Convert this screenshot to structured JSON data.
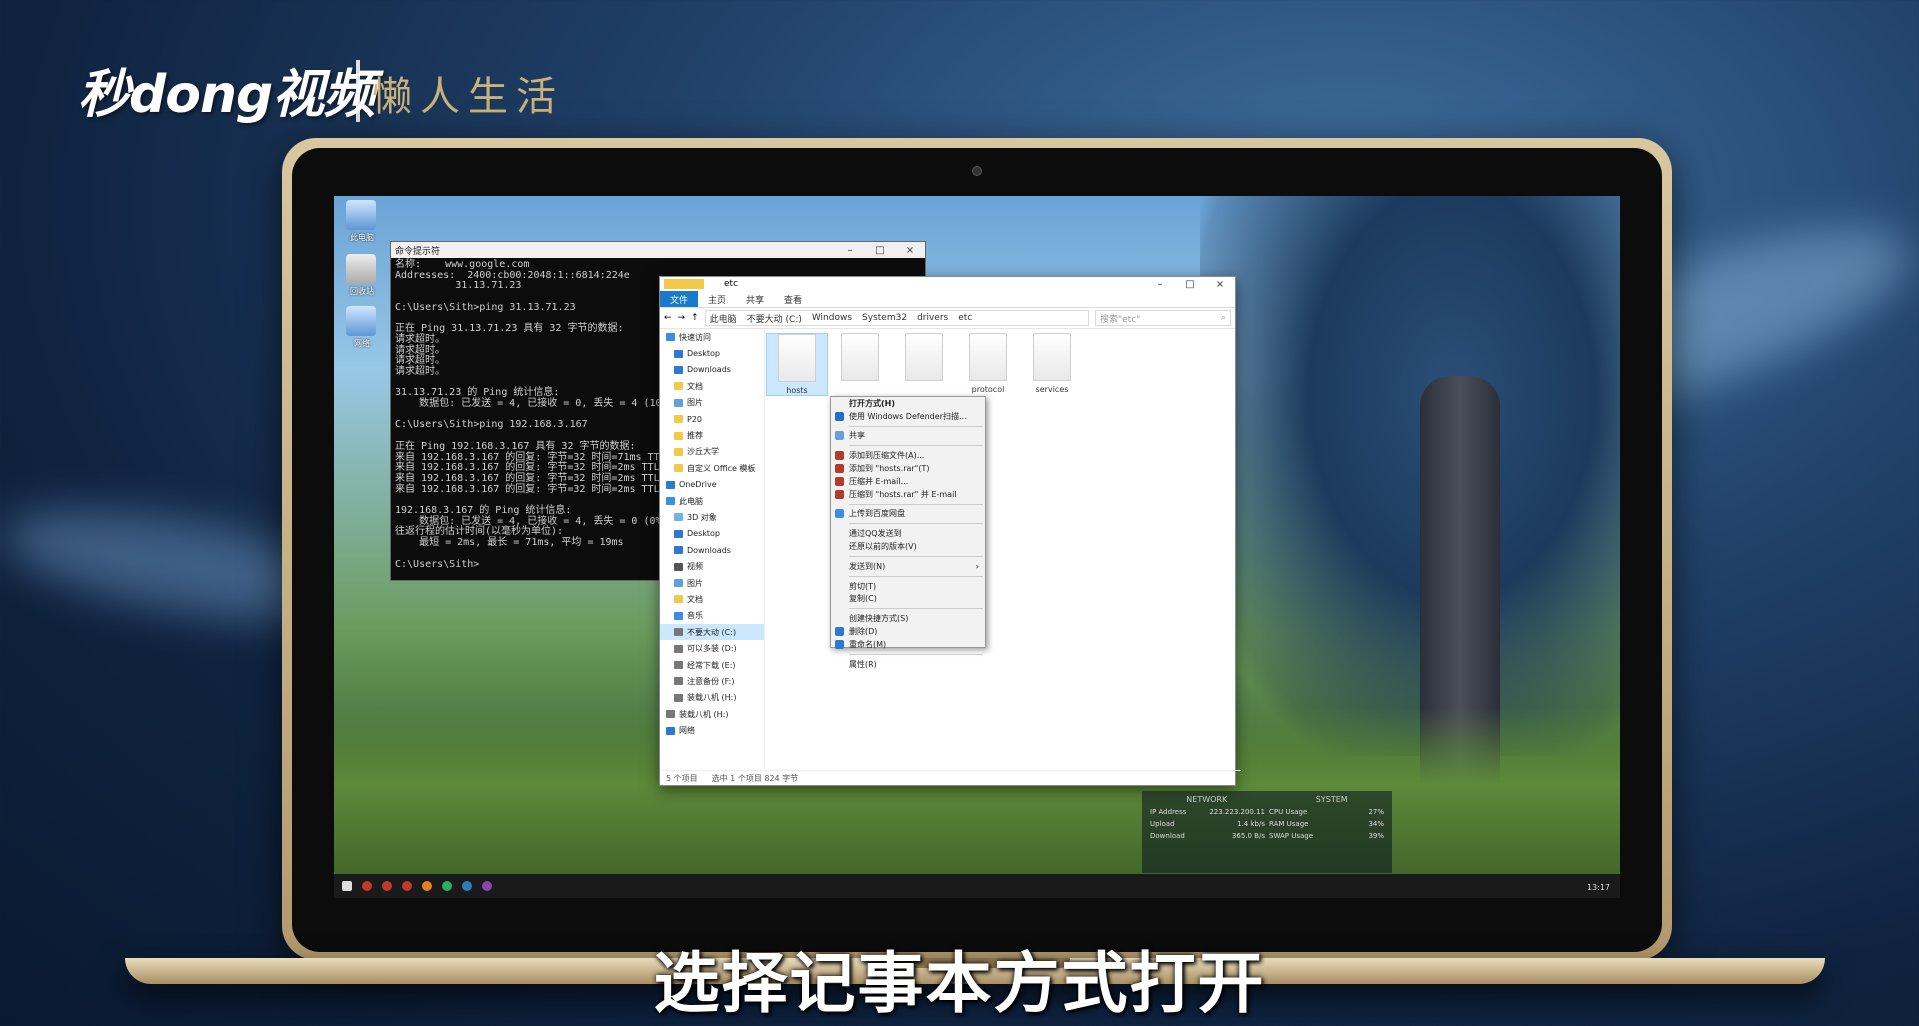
{
  "branding": {
    "logo": "秒dong视频",
    "sub": "懒人生活"
  },
  "desktop": {
    "icons": [
      {
        "label": "此电脑"
      },
      {
        "label": "回收站"
      },
      {
        "label": "网络"
      }
    ]
  },
  "cmd": {
    "title": "命令提示符",
    "lines": [
      "名称:    www.google.com",
      "Addresses:  2400:cb00:2048:1::6814:224e",
      "          31.13.71.23",
      "",
      "C:\\Users\\Sith>ping 31.13.71.23",
      "",
      "正在 Ping 31.13.71.23 具有 32 字节的数据:",
      "请求超时。",
      "请求超时。",
      "请求超时。",
      "请求超时。",
      "",
      "31.13.71.23 的 Ping 统计信息:",
      "    数据包: 已发送 = 4, 已接收 = 0, 丢失 = 4 (100%",
      "",
      "C:\\Users\\Sith>ping 192.168.3.167",
      "",
      "正在 Ping 192.168.3.167 具有 32 字节的数据:",
      "来自 192.168.3.167 的回复: 字节=32 时间=71ms TTL=",
      "来自 192.168.3.167 的回复: 字节=32 时间=2ms TTL=",
      "来自 192.168.3.167 的回复: 字节=32 时间=2ms TTL=",
      "来自 192.168.3.167 的回复: 字节=32 时间=2ms TTL=",
      "",
      "192.168.3.167 的 Ping 统计信息:",
      "    数据包: 已发送 = 4, 已接收 = 4, 丢失 = 0 (0%",
      "往返行程的估计时间(以毫秒为单位):",
      "    最短 = 2ms, 最长 = 71ms, 平均 = 19ms",
      "",
      "C:\\Users\\Sith>"
    ]
  },
  "explorer": {
    "title": "etc",
    "ribbon": [
      "文件",
      "主页",
      "共享",
      "查看"
    ],
    "path": [
      "此电脑",
      "不要大动 (C:)",
      "Windows",
      "System32",
      "drivers",
      "etc"
    ],
    "search_placeholder": "搜索\"etc\"",
    "nav": [
      "快速访问",
      "Desktop",
      "Downloads",
      "文档",
      "图片",
      "P20",
      "推荐",
      "沙丘大学",
      "自定义 Office 模板",
      "OneDrive",
      "此电脑",
      "3D 对象",
      "Desktop",
      "Downloads",
      "视频",
      "图片",
      "文档",
      "音乐",
      "不要大动 (C:)",
      "可以多装 (D:)",
      "经常下载 (E:)",
      "注意备份 (F:)",
      "装载八机 (H:)",
      "装载八机 (H:)",
      "网络"
    ],
    "files": [
      {
        "name": "hosts"
      },
      {
        "name": ""
      },
      {
        "name": ""
      },
      {
        "name": "protocol"
      },
      {
        "name": "services"
      }
    ],
    "status": {
      "count": "5 个项目",
      "selected": "选中 1 个项目  824 字节"
    }
  },
  "context_menu": {
    "items": [
      {
        "label": "打开方式(H)",
        "bold": true
      },
      {
        "label": "使用 Windows Defender扫描..."
      },
      {
        "label": "共享"
      },
      {
        "label": "添加到压缩文件(A)..."
      },
      {
        "label": "添加到 \"hosts.rar\"(T)"
      },
      {
        "label": "压缩并 E-mail..."
      },
      {
        "label": "压缩到 \"hosts.rar\" 并 E-mail"
      },
      {
        "label": "上传到百度网盘"
      },
      {
        "label": "通过QQ发送到"
      },
      {
        "label": "还原以前的版本(V)"
      },
      {
        "label": "发送到(N)"
      },
      {
        "label": "剪切(T)"
      },
      {
        "label": "复制(C)"
      },
      {
        "label": "创建快捷方式(S)"
      },
      {
        "label": "删除(D)"
      },
      {
        "label": "重命名(M)"
      },
      {
        "label": "属性(R)"
      }
    ]
  },
  "widget": {
    "network": "NETWORK",
    "system": "SYSTEM",
    "net": [
      {
        "k": "IP Address",
        "v": "223.223.200.11"
      },
      {
        "k": "Upload",
        "v": "1.4 kb/s"
      },
      {
        "k": "Download",
        "v": "365.0 B/s"
      }
    ],
    "sys": [
      {
        "k": "CPU Usage",
        "v": "27%"
      },
      {
        "k": "RAM Usage",
        "v": "34%"
      },
      {
        "k": "SWAP Usage",
        "v": "39%"
      }
    ],
    "time": "13:17"
  },
  "subtitle": "选择记事本方式打开",
  "colors": {
    "accent": "#1979ca",
    "selection": "#cce8ff"
  }
}
